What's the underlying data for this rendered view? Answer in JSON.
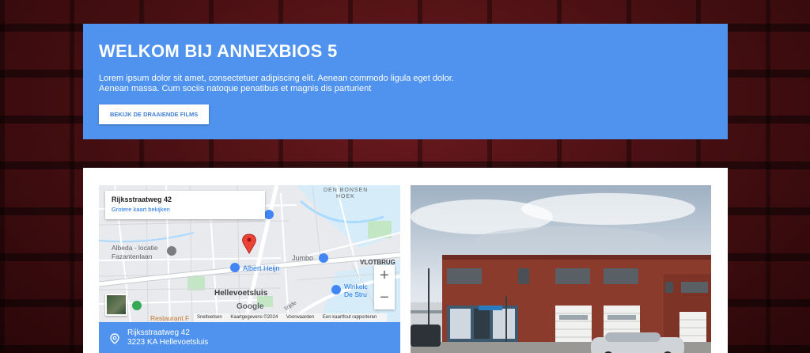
{
  "hero": {
    "title": "WELKOM BIJ ANNEXBIOS 5",
    "text": "Lorem ipsum dolor sit amet, consectetuer adipiscing elit. Aenean commodo ligula eget dolor. Aenean massa. Cum sociis natoque penatibus et magnis dis parturient",
    "cta_label": "BEKIJK DE DRAAIENDE FILMS"
  },
  "map": {
    "info_address": "Rijksstraatweg 42",
    "info_link": "Grotere kaart bekijken",
    "labels": {
      "den_bonsen": "DEN BONSEN",
      "hoek": "HOEK",
      "albeda_1": "Albeda - locatie",
      "albeda_2": "Fazantenlaan",
      "albert_heijn": "Albert Heijn",
      "jumbo": "Jumbo",
      "vlotbrug": "VLOTBRUG",
      "hellevoetsluis": "Hellevoetsluis",
      "winkel_1": "Winkelc",
      "winkel_2": "De Stru",
      "restaurant": "Restaurant F",
      "street_tzijde": "tzijde"
    },
    "google_logo": "Google",
    "attribution": [
      "Sneltoetsen",
      "Kaartgegevens ©2024",
      "Voorwaarden",
      "Een kaartfout rapporteren"
    ],
    "zoom_in": "+",
    "zoom_out": "−",
    "colors": {
      "road": "#ffffff",
      "water": "#aadaff",
      "park": "#c3e6c4",
      "land": "#e8eaed",
      "marker": "#ea4335",
      "poi_blue": "#4285f4"
    }
  },
  "address": {
    "line1": "Rijksstraatweg 42",
    "line2": "3223 KA Hellevoetsluis"
  },
  "colors": {
    "accent": "#4f93ee",
    "white": "#ffffff"
  }
}
